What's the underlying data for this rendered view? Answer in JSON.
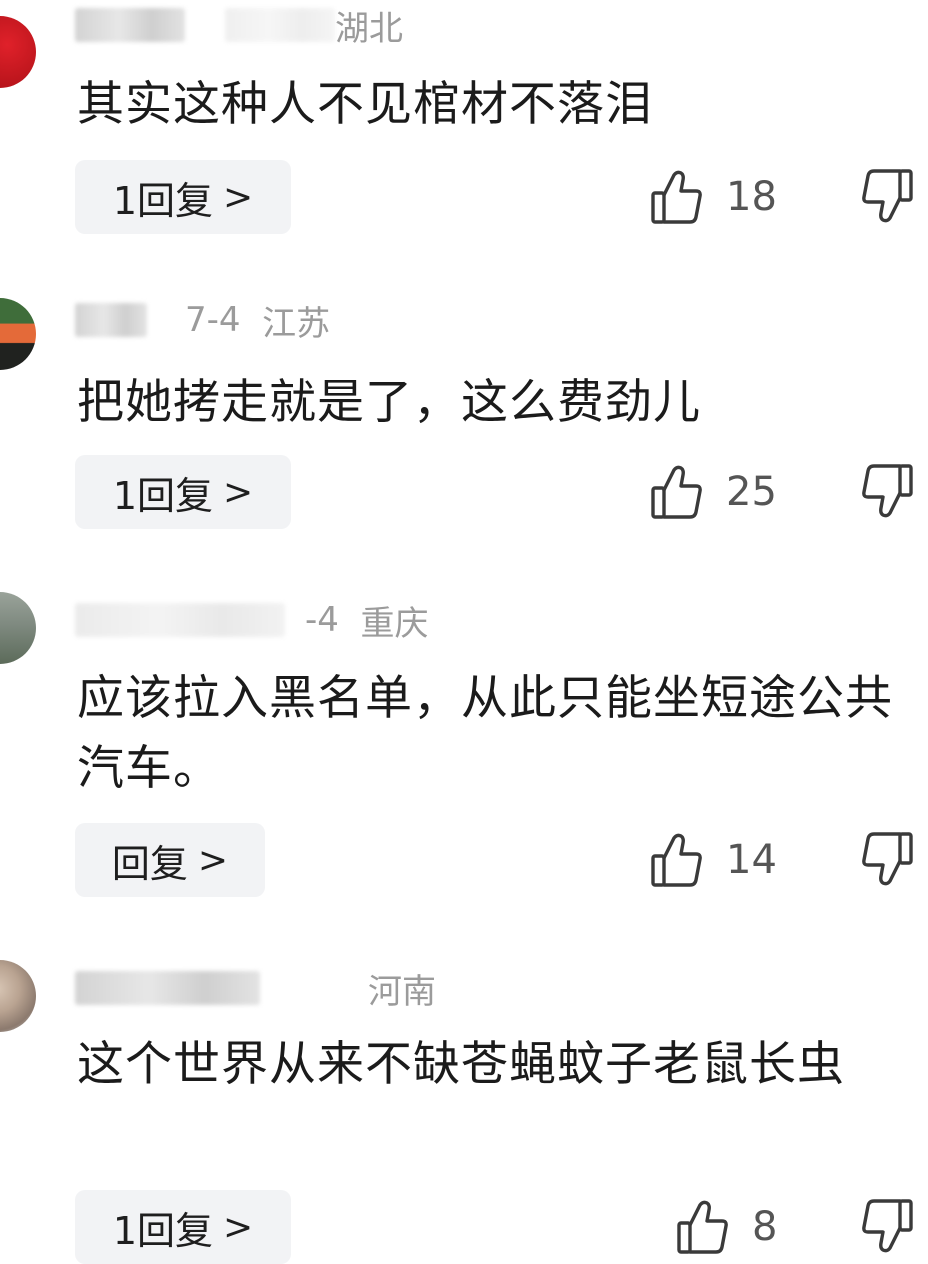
{
  "comments": [
    {
      "location": "湖北",
      "date": "",
      "text": "其实这种人不见棺材不落泪",
      "reply_label": "1回复",
      "reply_chevron": ">",
      "likes": "18"
    },
    {
      "location": "江苏",
      "date": "7-4",
      "text": "把她拷走就是了，这么费劲儿",
      "reply_label": "1回复",
      "reply_chevron": ">",
      "likes": "25"
    },
    {
      "location": "重庆",
      "date": "-4",
      "text": "应该拉入黑名单，从此只能坐短途公共汽车。",
      "reply_label": "回复",
      "reply_chevron": ">",
      "likes": "14"
    },
    {
      "location": "河南",
      "date": "",
      "text": "这个世界从来不缺苍蝇蚊子老鼠长虫",
      "reply_label": "1回复",
      "reply_chevron": ">",
      "likes": "8"
    }
  ],
  "icons": {
    "like": "thumbs-up-icon",
    "dislike": "thumbs-down-icon",
    "chevron": "chevron-right-icon"
  },
  "colors": {
    "meta_text": "#9b9b9b",
    "reply_bg": "#f2f3f5",
    "body_text": "#1b1b1b"
  }
}
